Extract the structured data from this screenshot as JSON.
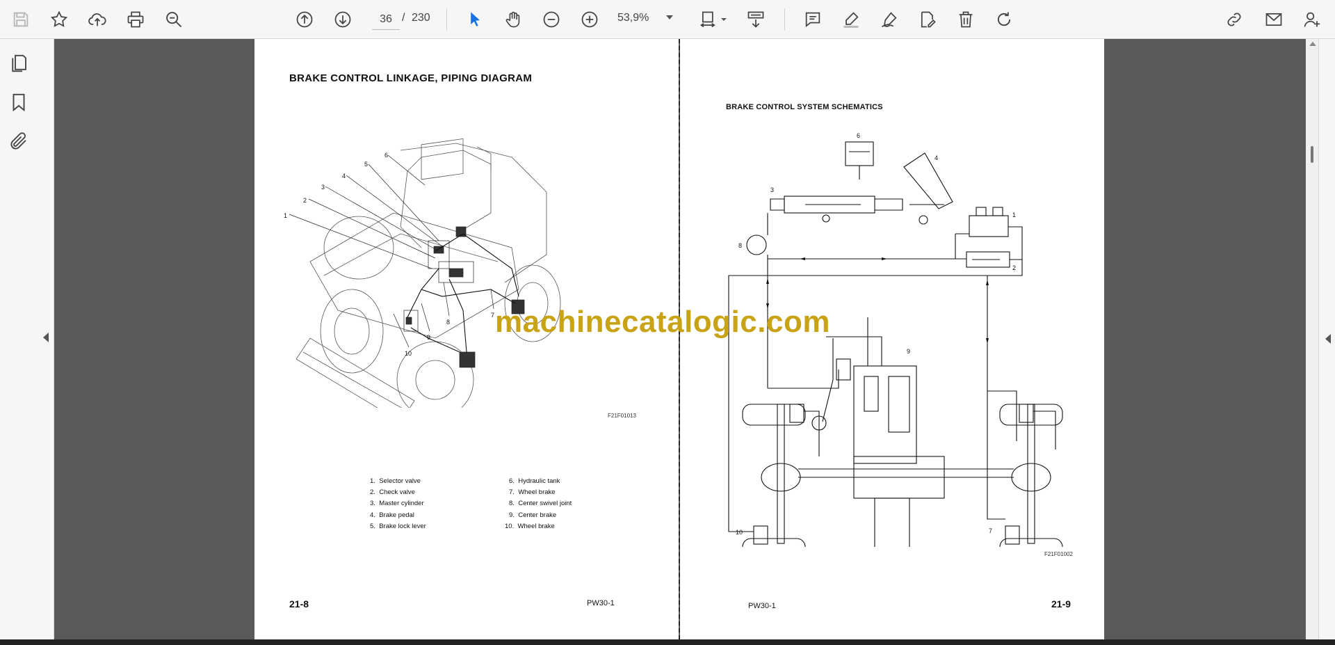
{
  "toolbar": {
    "page_current": "36",
    "page_separator": "/",
    "page_total": "230",
    "zoom": "53,9%"
  },
  "left_page": {
    "title": "BRAKE CONTROL LINKAGE, PIPING DIAGRAM",
    "figure_code": "F21F01013",
    "callouts": [
      "1",
      "2",
      "3",
      "4",
      "5",
      "6",
      "7",
      "8",
      "9",
      "10"
    ],
    "legend": [
      {
        "n": "1.",
        "label": "Selector valve"
      },
      {
        "n": "2.",
        "label": "Check valve"
      },
      {
        "n": "3.",
        "label": "Master cylinder"
      },
      {
        "n": "4.",
        "label": "Brake pedal"
      },
      {
        "n": "5.",
        "label": "Brake lock lever"
      },
      {
        "n": "6.",
        "label": "Hydraulic tank"
      },
      {
        "n": "7.",
        "label": "Wheel brake"
      },
      {
        "n": "8.",
        "label": "Center swivel joint"
      },
      {
        "n": "9.",
        "label": "Center brake"
      },
      {
        "n": "10.",
        "label": "Wheel brake"
      }
    ],
    "page_number": "21-8",
    "model": "PW30-1"
  },
  "right_page": {
    "title": "BRAKE CONTROL SYSTEM SCHEMATICS",
    "figure_code": "F21F01002",
    "callouts": [
      "6",
      "4",
      "3",
      "1",
      "8",
      "2",
      "9",
      "10",
      "7"
    ],
    "page_number": "21-9",
    "model": "PW30-1"
  },
  "watermark": "machinecatalogic.com",
  "colors": {
    "accent": "#1473e6",
    "watermark": "#c9a316",
    "viewer_bg": "#5a5a5a",
    "toolbar_bg": "#f6f6f6"
  },
  "icons": {
    "toolbar": [
      "save-icon",
      "bookmark-star-icon",
      "upload-cloud-icon",
      "print-icon",
      "zoom-search-icon",
      "page-up-icon",
      "page-down-icon",
      "select-cursor-icon",
      "hand-pan-icon",
      "zoom-out-icon",
      "zoom-in-icon",
      "fit-page-icon",
      "scroll-mode-icon",
      "comment-icon",
      "highlight-pen-icon",
      "sign-icon",
      "edit-pdf-icon",
      "delete-icon",
      "rotate-icon",
      "share-link-icon",
      "email-icon",
      "add-user-icon"
    ],
    "left_rail": [
      "pages-thumbnail-icon",
      "bookmarks-icon",
      "attachments-icon"
    ]
  }
}
